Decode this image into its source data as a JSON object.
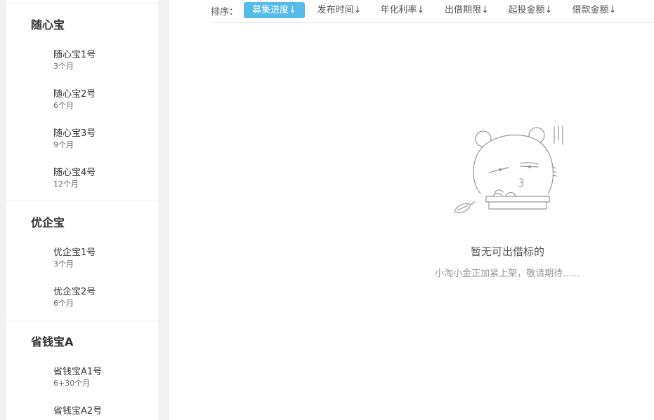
{
  "sidebar": {
    "groups": [
      {
        "title": "随心宝",
        "items": [
          {
            "name": "随心宝1号",
            "period": "3个月"
          },
          {
            "name": "随心宝2号",
            "period": "6个月"
          },
          {
            "name": "随心宝3号",
            "period": "9个月"
          },
          {
            "name": "随心宝4号",
            "period": "12个月"
          }
        ]
      },
      {
        "title": "优企宝",
        "items": [
          {
            "name": "优企宝1号",
            "period": "3个月"
          },
          {
            "name": "优企宝2号",
            "period": "6个月"
          }
        ]
      },
      {
        "title": "省钱宝A",
        "items": [
          {
            "name": "省钱宝A1号",
            "period": "6+30个月"
          },
          {
            "name": "省钱宝A2号",
            "period": ""
          }
        ]
      }
    ]
  },
  "sortbar": {
    "label": "排序：",
    "options": [
      {
        "label": "募集进度↓",
        "active": true
      },
      {
        "label": "发布时间↓",
        "active": false
      },
      {
        "label": "年化利率↓",
        "active": false
      },
      {
        "label": "出借期限↓",
        "active": false
      },
      {
        "label": "起投金额↓",
        "active": false
      },
      {
        "label": "借款金额↓",
        "active": false
      }
    ],
    "active_color": "#57bbe8"
  },
  "empty_state": {
    "illustration": "mascot-peeking-over-desk-icon",
    "title": "暂无可出借标的",
    "subtitle": "小淘小金正加紧上架，敬请期待......"
  }
}
